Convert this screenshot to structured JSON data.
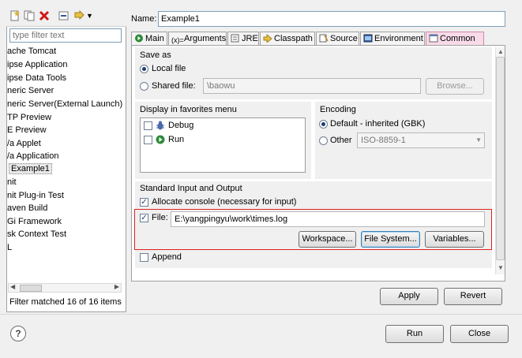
{
  "sidebar": {
    "filter_placeholder": "type filter text",
    "items": [
      "ache Tomcat",
      "ipse Application",
      "ipse Data Tools",
      "neric Server",
      "neric Server(External Launch)",
      "TP Preview",
      "E Preview",
      "/a Applet",
      "/a Application",
      "Example1",
      "nit",
      "nit Plug-in Test",
      "aven Build",
      "Gi Framework",
      "sk Context Test",
      "L"
    ],
    "status": "Filter matched 16 of 16 items"
  },
  "name": {
    "label": "Name:",
    "value": "Example1"
  },
  "tabs": [
    "Main",
    "Arguments",
    "JRE",
    "Classpath",
    "Source",
    "Environment",
    "Common"
  ],
  "save_as": {
    "title": "Save as",
    "local_file": "Local file",
    "shared_file": "Shared file:",
    "shared_path": "\\baowu",
    "browse": "Browse..."
  },
  "favorites": {
    "title": "Display in favorites menu",
    "items": [
      "Debug",
      "Run"
    ]
  },
  "encoding": {
    "title": "Encoding",
    "default_label": "Default - inherited (GBK)",
    "other_label": "Other",
    "other_value": "ISO-8859-1"
  },
  "std_io": {
    "title": "Standard Input and Output",
    "allocate_console": "Allocate console (necessary for input)",
    "file_label": "File:",
    "file_value": "E:\\yangpingyu\\work\\times.log",
    "workspace": "Workspace...",
    "file_system": "File System...",
    "variables": "Variables...",
    "append": "Append"
  },
  "actions": {
    "apply": "Apply",
    "revert": "Revert",
    "run": "Run",
    "close": "Close"
  },
  "colors": {
    "active_tab": "#f8dbe8",
    "highlight_border": "#e02020"
  }
}
